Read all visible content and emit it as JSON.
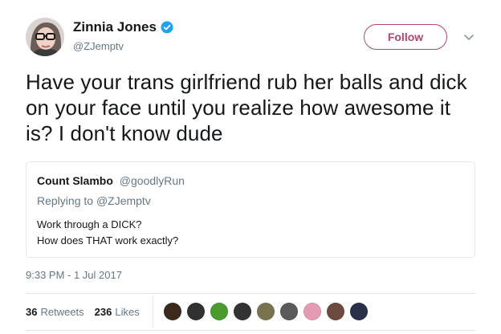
{
  "author": {
    "display_name": "Zinnia Jones",
    "handle": "@ZJemptv",
    "verified": true,
    "avatar_icon": "author-avatar"
  },
  "follow_label": "Follow",
  "menu_icon": "chevron-down-icon",
  "tweet_text": "Have your trans girlfriend rub her balls and dick on your face until you realize how awesome it is? I don't know dude",
  "quote": {
    "display_name": "Count Slambo",
    "handle": "@goodlyRun",
    "replying_prefix": "Replying to",
    "replying_to": "@ZJemptv",
    "line1": "Work through a DICK?",
    "line2": "How does THAT work exactly?"
  },
  "timestamp": "9:33 PM - 1 Jul 2017",
  "stats": {
    "retweets_count": "36",
    "retweets_label": "Retweets",
    "likes_count": "236",
    "likes_label": "Likes"
  },
  "likers": [
    {
      "name": "liker-avatar-1",
      "color": "#3a2a1c"
    },
    {
      "name": "liker-avatar-2",
      "color": "#2f3133"
    },
    {
      "name": "liker-avatar-3",
      "color": "#4a9a2e"
    },
    {
      "name": "liker-avatar-4",
      "color": "#333333"
    },
    {
      "name": "liker-avatar-5",
      "color": "#7a7350"
    },
    {
      "name": "liker-avatar-6",
      "color": "#5a5a5a"
    },
    {
      "name": "liker-avatar-7",
      "color": "#e59ab4"
    },
    {
      "name": "liker-avatar-8",
      "color": "#6b4a3f"
    },
    {
      "name": "liker-avatar-9",
      "color": "#28304a"
    }
  ],
  "colors": {
    "accent": "#b0466e",
    "verified": "#1da1f2",
    "muted_text": "#657786",
    "border": "#e1e8ed"
  }
}
